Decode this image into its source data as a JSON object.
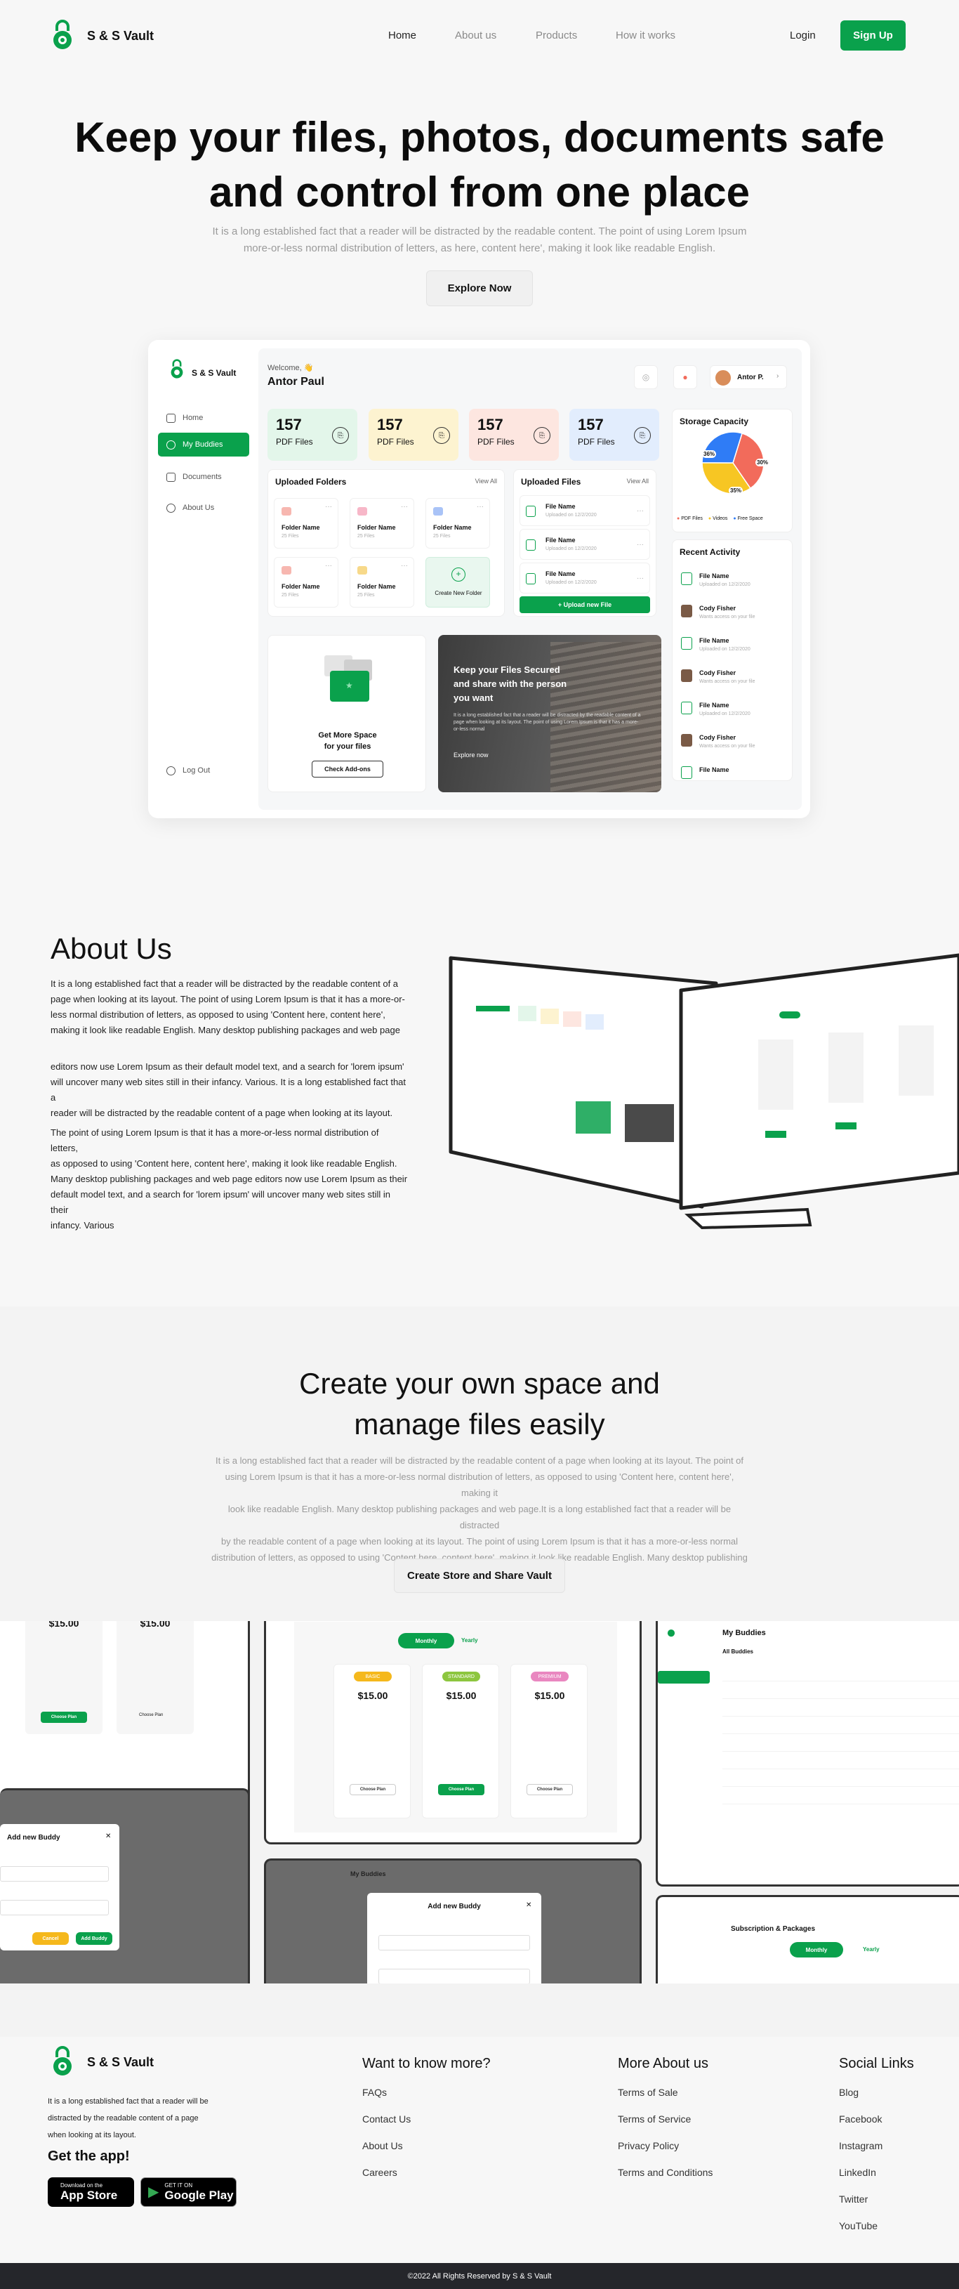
{
  "brand": {
    "name": "S & S Vault"
  },
  "nav": {
    "links": [
      "Home",
      "About us",
      "Products",
      "How it works"
    ],
    "login": "Login",
    "signup": "Sign Up"
  },
  "hero": {
    "title_line1": "Keep your files, photos, documents safe",
    "title_line2": "and control from one place",
    "subtitle_line1": "It is a long established fact that a reader will be distracted by the readable content. The point of using Lorem Ipsum",
    "subtitle_line2": "more-or-less normal distribution of letters, as here, content here', making it look like readable English.",
    "cta": "Explore Now"
  },
  "dashboard": {
    "brand": "S & S Vault",
    "sidebar": [
      "Home",
      "My Buddies",
      "Documents",
      "About Us"
    ],
    "logout": "Log Out",
    "welcome": "Welcome, 👋",
    "username": "Antor Paul",
    "user_short": "Antor P.",
    "stats": [
      {
        "number": "157",
        "label": "PDF Files",
        "bg": "#e3f6ea"
      },
      {
        "number": "157",
        "label": "PDF Files",
        "bg": "#fdf3d0"
      },
      {
        "number": "157",
        "label": "PDF Files",
        "bg": "#fde6e0"
      },
      {
        "number": "157",
        "label": "PDF Files",
        "bg": "#e2edfd"
      }
    ],
    "folders_title": "Uploaded Folders",
    "view_all": "View All",
    "folders": [
      {
        "name": "Folder Name",
        "size": "25 Files",
        "color": "#f7b7b0"
      },
      {
        "name": "Folder Name",
        "size": "25 Files",
        "color": "#f7b7c8"
      },
      {
        "name": "Folder Name",
        "size": "25 Files",
        "color": "#a9c3f7"
      },
      {
        "name": "Folder Name",
        "size": "25 Files",
        "color": "#f7b7b0"
      },
      {
        "name": "Folder Name",
        "size": "25 Files",
        "color": "#f7d98a"
      }
    ],
    "create_folder": "Create New Folder",
    "files_title": "Uploaded Files",
    "files": [
      {
        "name": "File Name",
        "meta": "Uploaded on 12/2/2020"
      },
      {
        "name": "File Name",
        "meta": "Uploaded on 12/2/2020"
      },
      {
        "name": "File Name",
        "meta": "Uploaded on 12/2/2020"
      }
    ],
    "upload_button": "+ Upload new File",
    "storage": {
      "title": "Storage Capacity",
      "slices": [
        {
          "label": "PDF Files",
          "value": 36,
          "color": "#f26b5b"
        },
        {
          "label": "Videos",
          "value": 35,
          "color": "#f7c623"
        },
        {
          "label": "Free Space",
          "value": 30,
          "color": "#2f7cf6"
        }
      ],
      "labels": [
        "36%",
        "35%",
        "30%"
      ]
    },
    "activity_title": "Recent Activity",
    "activity": [
      {
        "name": "File Name",
        "meta": "Uploaded on 12/2/2020",
        "type": "file"
      },
      {
        "name": "Cody Fisher",
        "meta": "Wants access on your file",
        "type": "person"
      },
      {
        "name": "File Name",
        "meta": "Uploaded on 12/2/2020",
        "type": "file"
      },
      {
        "name": "Cody Fisher",
        "meta": "Wants access on your file",
        "type": "person"
      },
      {
        "name": "File Name",
        "meta": "Uploaded on 12/2/2020",
        "type": "file"
      },
      {
        "name": "Cody Fisher",
        "meta": "Wants access on your file",
        "type": "person"
      },
      {
        "name": "File Name",
        "meta": "",
        "type": "file"
      }
    ],
    "addons": {
      "title_line1": "Get More Space",
      "title_line2": "for your files",
      "cta": "Check Add-ons"
    },
    "promo": {
      "title_line1": "Keep your Files Secured",
      "title_line2": "and share with the person",
      "title_line3": "you want",
      "body": "It is a long established fact that a reader will be distracted by the readable content of a page when looking at its layout. The point of using Lorem Ipsum is that it has a more-or-less normal",
      "cta": "Explore now"
    }
  },
  "about": {
    "title": "About Us",
    "p1_lines": [
      "It is a long established fact that a reader will be distracted by the readable content of a",
      "page when looking at its layout. The point of using Lorem Ipsum is that it has a more-or-",
      "less normal distribution of letters, as opposed to using 'Content here, content here',",
      "making it look like readable English. Many desktop publishing packages and web page"
    ],
    "p2_lines": [
      "editors now use Lorem Ipsum as their default model text, and a search for 'lorem ipsum'",
      "will uncover many web sites still in their infancy. Various. It is a long established fact that a",
      "reader will be distracted by the readable content of a page when looking at its layout."
    ],
    "p3_lines": [
      "The point of using Lorem Ipsum is that it has a more-or-less normal distribution of letters,",
      "as opposed to using 'Content here, content here', making it look like readable English.",
      "Many desktop publishing packages and web page editors now use Lorem Ipsum as their",
      "default model text, and a search for 'lorem ipsum' will uncover many web sites still in their",
      "infancy. Various"
    ]
  },
  "create": {
    "title_line1": "Create your own space and",
    "title_line2": "manage files easily",
    "sub_lines": [
      "It is a long established fact that a reader will be distracted by the readable content of a page when looking at its layout. The point of",
      "using Lorem Ipsum is that it has a more-or-less normal distribution of letters, as opposed to using 'Content here, content here', making it",
      "look like readable English. Many desktop publishing packages and web page.It is a long established fact that a reader will be distracted",
      "by the readable content of a page when looking at its layout. The point of using Lorem Ipsum is that it has a more-or-less normal",
      "distribution of letters, as opposed to using 'Content here, content here', making it look like readable English. Many desktop publishing",
      "packages and web page."
    ],
    "cta": "Create Store and Share Vault"
  },
  "mockups": {
    "monthly": "Monthly",
    "yearly": "Yearly",
    "price": "$15.00",
    "plans": [
      {
        "badge": "BASIC",
        "color": "#f5b81c"
      },
      {
        "badge": "STANDARD",
        "color": "#8dc63f"
      },
      {
        "badge": "PREMIUM",
        "color": "#e987c0"
      }
    ],
    "choose_plan": "Choose Plan",
    "add_buddy": "Add new Buddy",
    "my_buddies": "My Buddies",
    "all_buddies": "All Buddies",
    "subscription": "Subscription & Packages",
    "add_buddy_btn": "Add Buddy",
    "cancel_btn": "Cancel"
  },
  "footer": {
    "brand": "S & S Vault",
    "desc_lines": [
      "It is a long established fact that a reader will be",
      "distracted by the readable content of a page",
      "when looking at its layout."
    ],
    "get_app": "Get the app!",
    "appstore_top": "Download on the",
    "appstore": "App Store",
    "gplay_top": "GET IT ON",
    "gplay": "Google Play",
    "col1_title": "Want to know more?",
    "col1": [
      "FAQs",
      "Contact Us",
      "About Us",
      "Careers"
    ],
    "col2_title": "More About us",
    "col2": [
      "Terms of Sale",
      "Terms of Service",
      "Privacy Policy",
      "Terms and Conditions"
    ],
    "col3_title": "Social Links",
    "col3": [
      "Blog",
      "Facebook",
      "Instagram",
      "LinkedIn",
      "Twitter",
      "YouTube"
    ],
    "copyright": "©2022 All Rights Reserved by S & S Vault"
  },
  "colors": {
    "accent": "#0aa14c",
    "footer_bar": "#25262b"
  }
}
